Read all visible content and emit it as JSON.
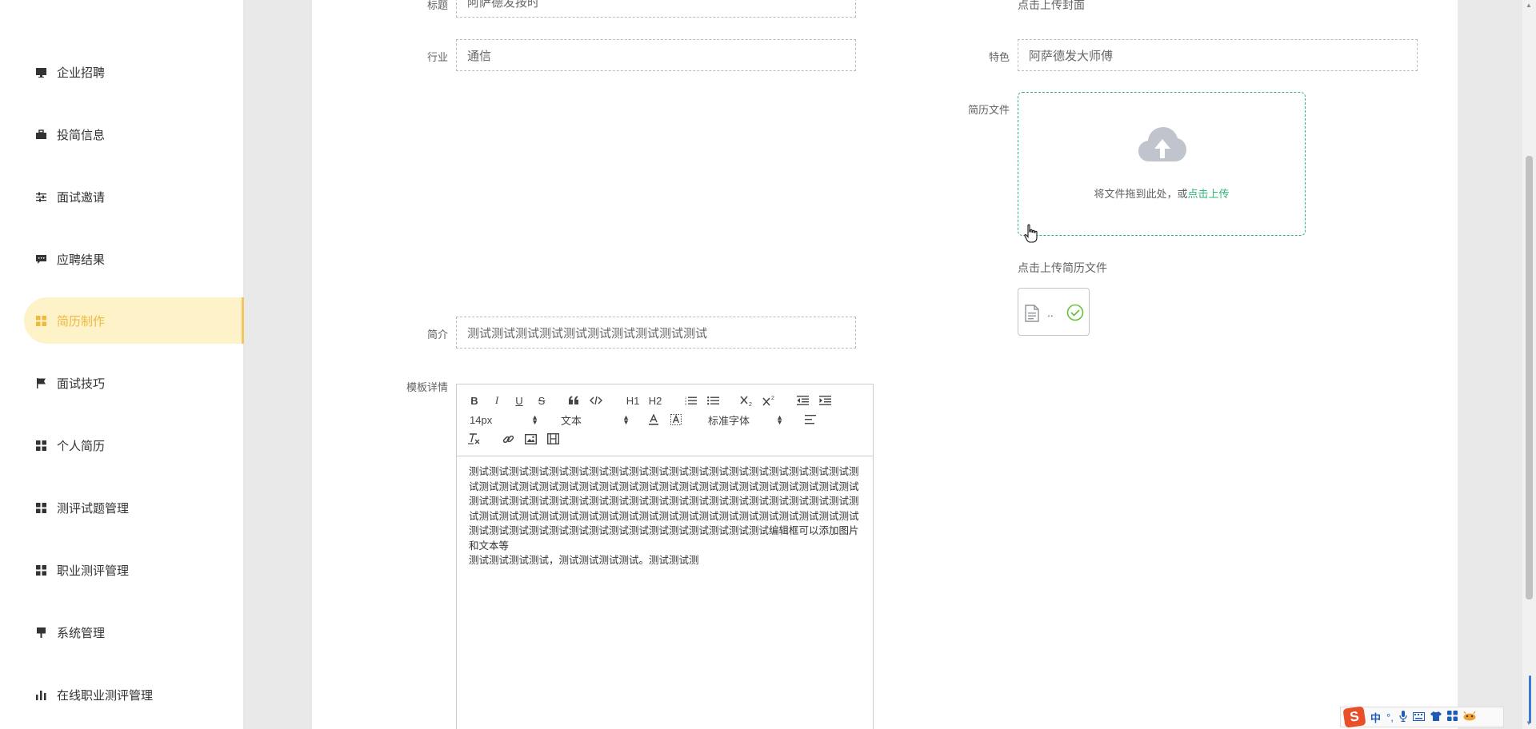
{
  "sidebar": {
    "items": [
      {
        "label": "企业招聘",
        "icon": "monitor-icon",
        "active": false
      },
      {
        "label": "投简信息",
        "icon": "briefcase-icon",
        "active": false
      },
      {
        "label": "面试邀请",
        "icon": "sliders-icon",
        "active": false
      },
      {
        "label": "应聘结果",
        "icon": "chat-icon",
        "active": false
      },
      {
        "label": "简历制作",
        "icon": "grid-icon",
        "active": true
      },
      {
        "label": "面试技巧",
        "icon": "flag-icon",
        "active": false
      },
      {
        "label": "个人简历",
        "icon": "grid-icon",
        "active": false
      },
      {
        "label": "测评试题管理",
        "icon": "grid-icon",
        "active": false
      },
      {
        "label": "职业测评管理",
        "icon": "grid-icon",
        "active": false
      },
      {
        "label": "系统管理",
        "icon": "brush-icon",
        "active": false
      },
      {
        "label": "在线职业测评管理",
        "icon": "bar-chart-icon",
        "active": false
      }
    ]
  },
  "form": {
    "title": {
      "label": "标题",
      "value": "阿萨德发按时"
    },
    "cover_hint": "点击上传封面",
    "industry": {
      "label": "行业",
      "value": "通信"
    },
    "feature": {
      "label": "特色",
      "value": "阿萨德发大师傅"
    },
    "resume_file": {
      "label": "简历文件",
      "drop_text": "将文件拖到此处，或",
      "drop_link": "点击上传",
      "hint": "点击上传简历文件",
      "file_name": ".."
    },
    "intro": {
      "label": "简介",
      "value": "测试测试测试测试测试测试测试测试测试测试"
    },
    "template": {
      "label": "模板详情",
      "toolbar": {
        "bold": "B",
        "italic": "I",
        "underline": "U",
        "strike": "S",
        "h1": "H1",
        "h2": "H2",
        "font_size": "14px",
        "block_type": "文本",
        "font_family": "标准字体"
      },
      "content_p1": "测试测试测试测试测试测试测试测试测试测试测试测试测试测试测试测试测试测试测试测试测试测试测试测试测试测试测试测试测试测试测试测试测试测试测试测试测试测试测试测试测试测试测试测试测试测试测试测试测试测试测试测试测试测试测试测试测试测试测试测试测试测试测试测试测试测试测试测试测试测试测试测试测试测试测试测试测试测试测试测试测试测试测试测试测试测试测试测试测试测试测试测试测试编辑框可以添加图片和文本等",
      "content_p2": "测试测试测试测试，测试测试测试测试。测试测试测"
    }
  },
  "ime": {
    "lang": "中"
  },
  "colors": {
    "accent": "#2eb676",
    "active_menu_bg": "#fdf2c8",
    "active_menu_text": "#f0b83e"
  }
}
